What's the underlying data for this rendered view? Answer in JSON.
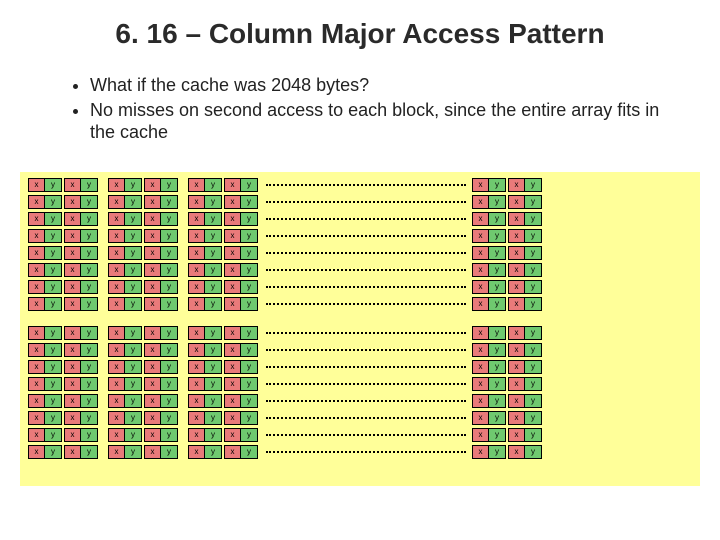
{
  "title": "6. 16 – Column Major Access Pattern",
  "bullets": [
    "What if the cache was 2048 bytes?",
    "No misses on second access to each block, since the entire array fits in the cache"
  ],
  "labels": {
    "x": "x",
    "y": "y"
  },
  "layout": {
    "sections": 2,
    "rows_per_section": 8,
    "left_groups": 3,
    "pairs_per_group": 2,
    "right_pairs": 2
  }
}
